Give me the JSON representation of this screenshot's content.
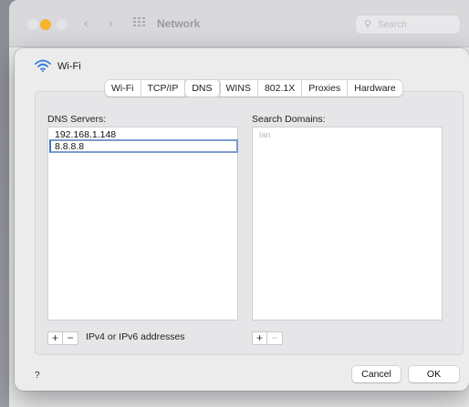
{
  "window": {
    "title": "Network",
    "search_placeholder": "Search"
  },
  "sheet": {
    "interface_name": "Wi-Fi",
    "tabs": [
      "Wi-Fi",
      "TCP/IP",
      "DNS",
      "WINS",
      "802.1X",
      "Proxies",
      "Hardware"
    ],
    "active_tab": "DNS",
    "dns_servers_label": "DNS Servers:",
    "dns_servers": [
      "192.168.1.148",
      "8.8.8.8"
    ],
    "search_domains_label": "Search Domains:",
    "search_domains": [
      "lan"
    ],
    "plus": "+",
    "minus": "−",
    "address_hint": "IPv4 or IPv6 addresses",
    "help": "?",
    "cancel": "Cancel",
    "ok": "OK"
  },
  "colors": {
    "accent": "#3a74c8",
    "traffic_yellow": "#f5b42a"
  }
}
